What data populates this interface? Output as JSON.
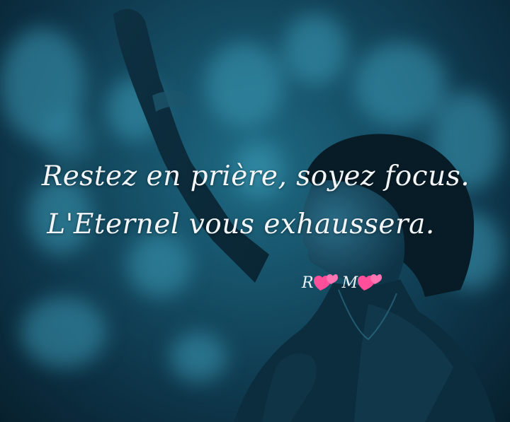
{
  "image": {
    "background_color": "#154f66",
    "accent_color": "#3d9bb6"
  },
  "quote": {
    "line1": "Restez  en prière, soyez focus.",
    "line2": "L'Eternel vous exhaussera."
  },
  "signature": {
    "initial_1": "R",
    "initial_2": "M",
    "icon": "two-hearts-icon",
    "heart_color": "#ff4f9b"
  }
}
